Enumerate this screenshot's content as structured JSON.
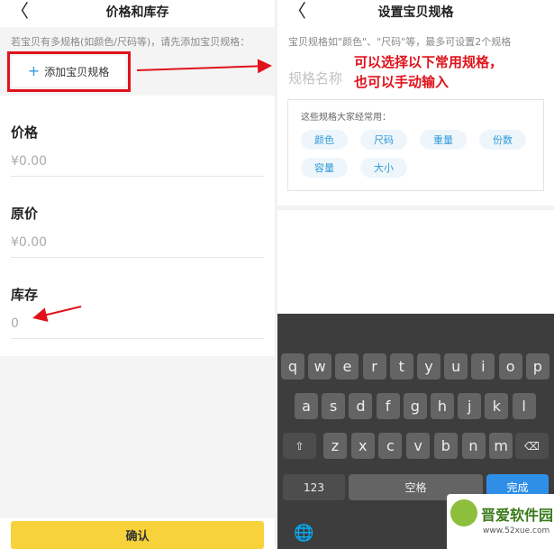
{
  "left": {
    "nav": {
      "back": "〈",
      "title": "价格和库存"
    },
    "hint": "若宝贝有多规格(如颜色/尺码等)，请先添加宝贝规格：",
    "add_spec": {
      "plus": "+",
      "label": "添加宝贝规格"
    },
    "fields": [
      {
        "label": "价格",
        "value": "¥0.00"
      },
      {
        "label": "原价",
        "value": "¥0.00"
      },
      {
        "label": "库存",
        "value": "0"
      }
    ],
    "confirm": "确认"
  },
  "right": {
    "nav": {
      "back": "〈",
      "title": "设置宝贝规格"
    },
    "hint": "宝贝规格如\"颜色\"、\"尺码\"等，最多可设置2个规格",
    "input_placeholder": "规格名称",
    "annotation": [
      "可以选择以下常用规格，",
      "也可以手动输入"
    ],
    "suggest": {
      "title": "这些规格大家经常用：",
      "chips": [
        "颜色",
        "尺码",
        "重量",
        "份数",
        "容量",
        "大小"
      ]
    },
    "keyboard": {
      "row1": [
        "q",
        "w",
        "e",
        "r",
        "t",
        "y",
        "u",
        "i",
        "o",
        "p"
      ],
      "row2": [
        "a",
        "s",
        "d",
        "f",
        "g",
        "h",
        "j",
        "k",
        "l"
      ],
      "row3": [
        "z",
        "x",
        "c",
        "v",
        "b",
        "n",
        "m"
      ],
      "shift": "⇧",
      "delete": "⌫",
      "num": "123",
      "space": "空格",
      "done": "完成",
      "globe": "🌐"
    },
    "watermark": {
      "title": "晋爱软件园",
      "url": "www.52xue.com"
    }
  },
  "colors": {
    "accent": "#2f9bd8",
    "highlight": "#e0121b",
    "confirm": "#f7d23a",
    "done_key": "#2f8fe6"
  }
}
